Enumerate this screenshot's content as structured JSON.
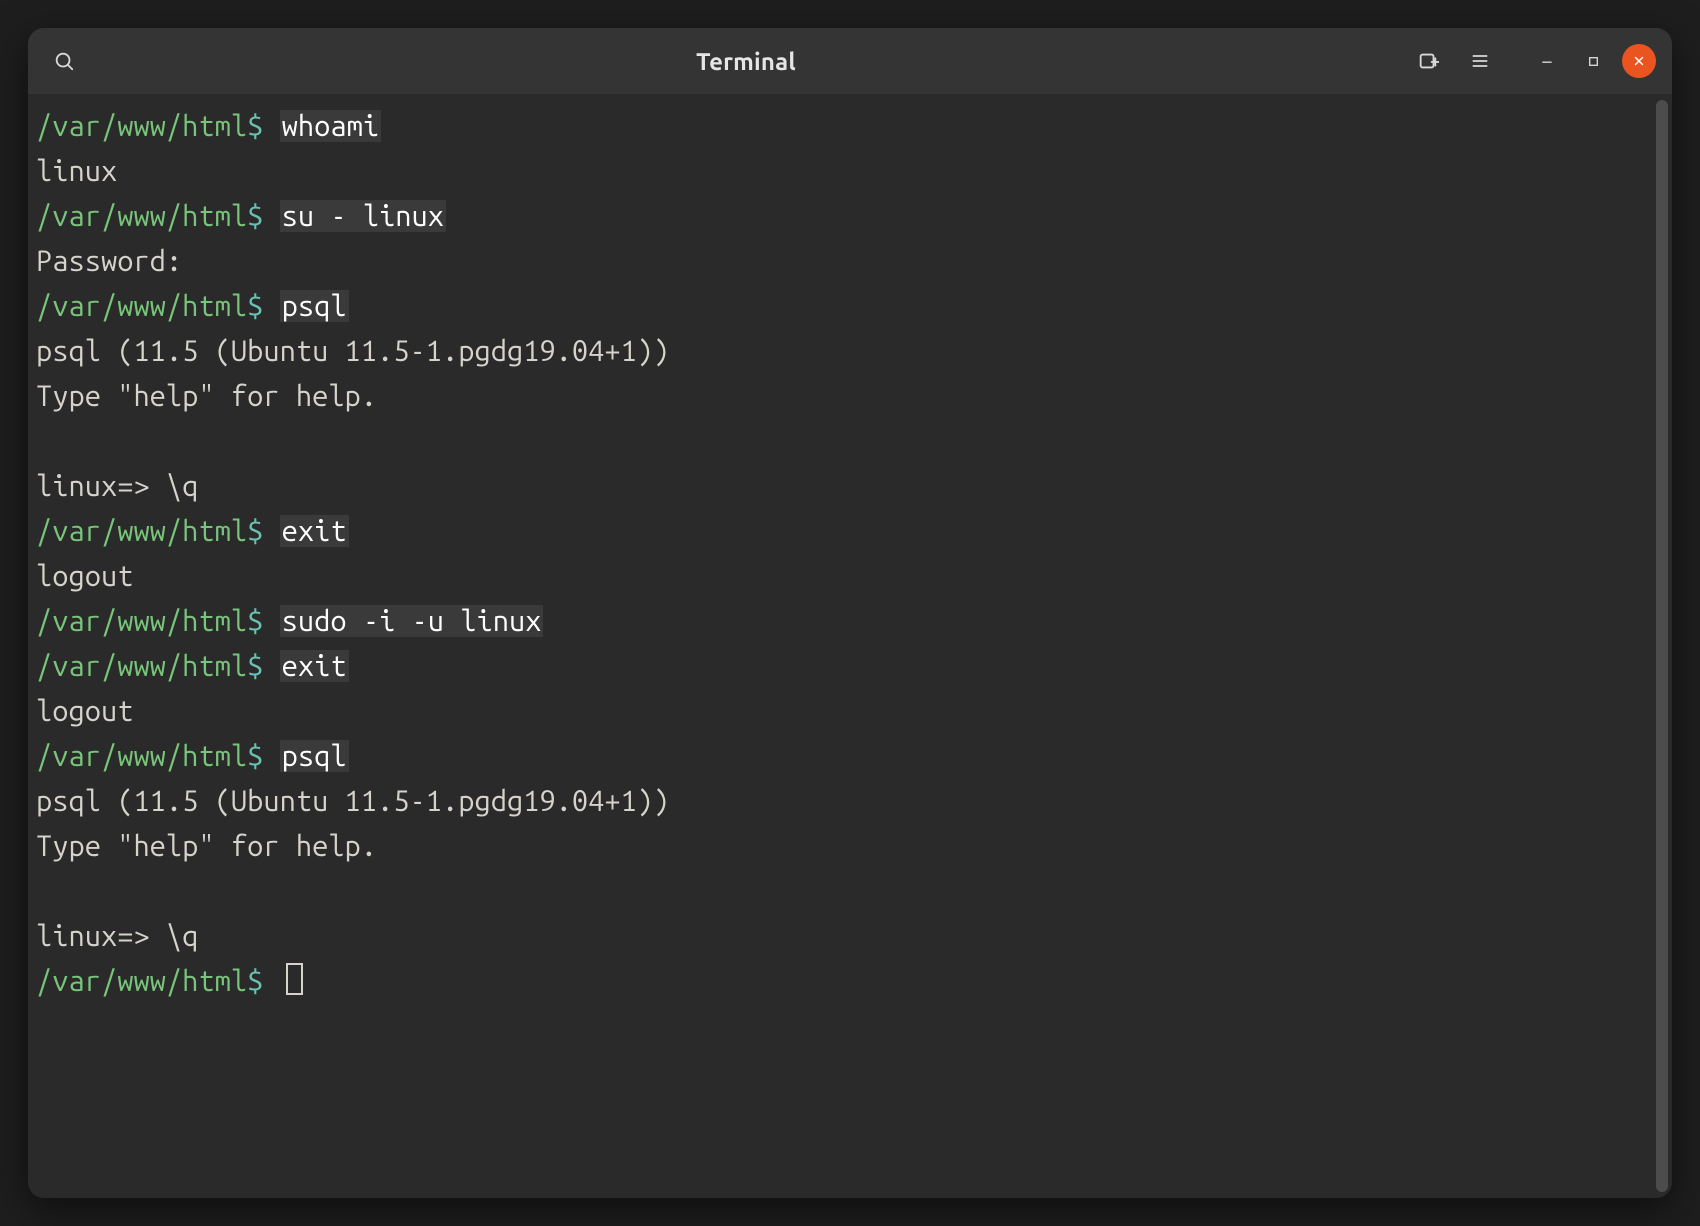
{
  "window": {
    "title": "Terminal"
  },
  "colors": {
    "path_green": "#78c47a",
    "dollar_teal": "#6ac0b2",
    "close_orange": "#e95420"
  },
  "prompt": {
    "path": "/var/www/html",
    "sep": "$"
  },
  "lines": [
    {
      "type": "prompt",
      "cmd": "whoami"
    },
    {
      "type": "out",
      "text": "linux"
    },
    {
      "type": "prompt",
      "cmd": "su - linux"
    },
    {
      "type": "out",
      "text": "Password:"
    },
    {
      "type": "prompt",
      "cmd": "psql"
    },
    {
      "type": "out",
      "text": "psql (11.5 (Ubuntu 11.5-1.pgdg19.04+1))"
    },
    {
      "type": "out",
      "text": "Type \"help\" for help."
    },
    {
      "type": "blank"
    },
    {
      "type": "psql",
      "prompt": "linux=> ",
      "cmd": "\\q"
    },
    {
      "type": "prompt",
      "cmd": "exit"
    },
    {
      "type": "out",
      "text": "logout"
    },
    {
      "type": "prompt",
      "cmd": "sudo -i -u linux"
    },
    {
      "type": "prompt",
      "cmd": "exit"
    },
    {
      "type": "out",
      "text": "logout"
    },
    {
      "type": "prompt",
      "cmd": "psql"
    },
    {
      "type": "out",
      "text": "psql (11.5 (Ubuntu 11.5-1.pgdg19.04+1))"
    },
    {
      "type": "out",
      "text": "Type \"help\" for help."
    },
    {
      "type": "blank"
    },
    {
      "type": "psql",
      "prompt": "linux=> ",
      "cmd": "\\q"
    },
    {
      "type": "prompt-cursor"
    }
  ]
}
